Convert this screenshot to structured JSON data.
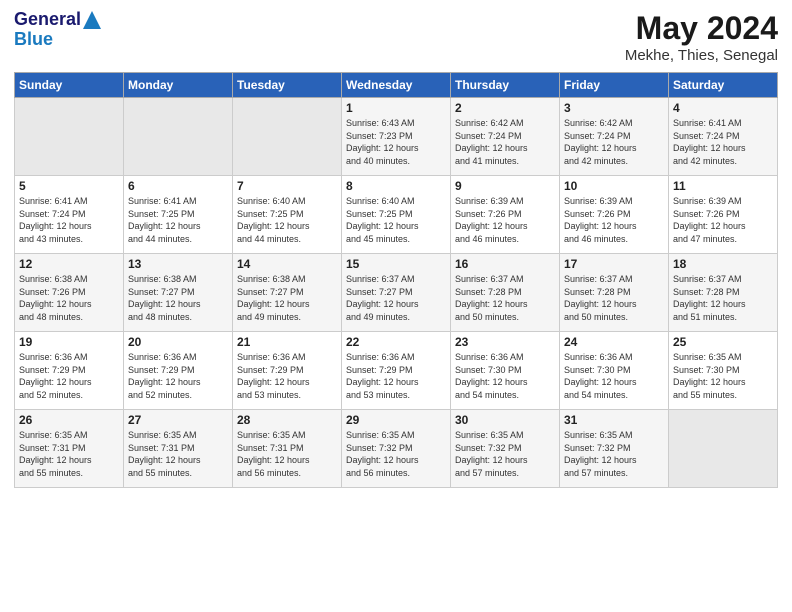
{
  "header": {
    "logo_line1": "General",
    "logo_line2": "Blue",
    "month": "May 2024",
    "location": "Mekhe, Thies, Senegal"
  },
  "days_of_week": [
    "Sunday",
    "Monday",
    "Tuesday",
    "Wednesday",
    "Thursday",
    "Friday",
    "Saturday"
  ],
  "weeks": [
    [
      {
        "day": "",
        "info": ""
      },
      {
        "day": "",
        "info": ""
      },
      {
        "day": "",
        "info": ""
      },
      {
        "day": "1",
        "info": "Sunrise: 6:43 AM\nSunset: 7:23 PM\nDaylight: 12 hours\nand 40 minutes."
      },
      {
        "day": "2",
        "info": "Sunrise: 6:42 AM\nSunset: 7:24 PM\nDaylight: 12 hours\nand 41 minutes."
      },
      {
        "day": "3",
        "info": "Sunrise: 6:42 AM\nSunset: 7:24 PM\nDaylight: 12 hours\nand 42 minutes."
      },
      {
        "day": "4",
        "info": "Sunrise: 6:41 AM\nSunset: 7:24 PM\nDaylight: 12 hours\nand 42 minutes."
      }
    ],
    [
      {
        "day": "5",
        "info": "Sunrise: 6:41 AM\nSunset: 7:24 PM\nDaylight: 12 hours\nand 43 minutes."
      },
      {
        "day": "6",
        "info": "Sunrise: 6:41 AM\nSunset: 7:25 PM\nDaylight: 12 hours\nand 44 minutes."
      },
      {
        "day": "7",
        "info": "Sunrise: 6:40 AM\nSunset: 7:25 PM\nDaylight: 12 hours\nand 44 minutes."
      },
      {
        "day": "8",
        "info": "Sunrise: 6:40 AM\nSunset: 7:25 PM\nDaylight: 12 hours\nand 45 minutes."
      },
      {
        "day": "9",
        "info": "Sunrise: 6:39 AM\nSunset: 7:26 PM\nDaylight: 12 hours\nand 46 minutes."
      },
      {
        "day": "10",
        "info": "Sunrise: 6:39 AM\nSunset: 7:26 PM\nDaylight: 12 hours\nand 46 minutes."
      },
      {
        "day": "11",
        "info": "Sunrise: 6:39 AM\nSunset: 7:26 PM\nDaylight: 12 hours\nand 47 minutes."
      }
    ],
    [
      {
        "day": "12",
        "info": "Sunrise: 6:38 AM\nSunset: 7:26 PM\nDaylight: 12 hours\nand 48 minutes."
      },
      {
        "day": "13",
        "info": "Sunrise: 6:38 AM\nSunset: 7:27 PM\nDaylight: 12 hours\nand 48 minutes."
      },
      {
        "day": "14",
        "info": "Sunrise: 6:38 AM\nSunset: 7:27 PM\nDaylight: 12 hours\nand 49 minutes."
      },
      {
        "day": "15",
        "info": "Sunrise: 6:37 AM\nSunset: 7:27 PM\nDaylight: 12 hours\nand 49 minutes."
      },
      {
        "day": "16",
        "info": "Sunrise: 6:37 AM\nSunset: 7:28 PM\nDaylight: 12 hours\nand 50 minutes."
      },
      {
        "day": "17",
        "info": "Sunrise: 6:37 AM\nSunset: 7:28 PM\nDaylight: 12 hours\nand 50 minutes."
      },
      {
        "day": "18",
        "info": "Sunrise: 6:37 AM\nSunset: 7:28 PM\nDaylight: 12 hours\nand 51 minutes."
      }
    ],
    [
      {
        "day": "19",
        "info": "Sunrise: 6:36 AM\nSunset: 7:29 PM\nDaylight: 12 hours\nand 52 minutes."
      },
      {
        "day": "20",
        "info": "Sunrise: 6:36 AM\nSunset: 7:29 PM\nDaylight: 12 hours\nand 52 minutes."
      },
      {
        "day": "21",
        "info": "Sunrise: 6:36 AM\nSunset: 7:29 PM\nDaylight: 12 hours\nand 53 minutes."
      },
      {
        "day": "22",
        "info": "Sunrise: 6:36 AM\nSunset: 7:29 PM\nDaylight: 12 hours\nand 53 minutes."
      },
      {
        "day": "23",
        "info": "Sunrise: 6:36 AM\nSunset: 7:30 PM\nDaylight: 12 hours\nand 54 minutes."
      },
      {
        "day": "24",
        "info": "Sunrise: 6:36 AM\nSunset: 7:30 PM\nDaylight: 12 hours\nand 54 minutes."
      },
      {
        "day": "25",
        "info": "Sunrise: 6:35 AM\nSunset: 7:30 PM\nDaylight: 12 hours\nand 55 minutes."
      }
    ],
    [
      {
        "day": "26",
        "info": "Sunrise: 6:35 AM\nSunset: 7:31 PM\nDaylight: 12 hours\nand 55 minutes."
      },
      {
        "day": "27",
        "info": "Sunrise: 6:35 AM\nSunset: 7:31 PM\nDaylight: 12 hours\nand 55 minutes."
      },
      {
        "day": "28",
        "info": "Sunrise: 6:35 AM\nSunset: 7:31 PM\nDaylight: 12 hours\nand 56 minutes."
      },
      {
        "day": "29",
        "info": "Sunrise: 6:35 AM\nSunset: 7:32 PM\nDaylight: 12 hours\nand 56 minutes."
      },
      {
        "day": "30",
        "info": "Sunrise: 6:35 AM\nSunset: 7:32 PM\nDaylight: 12 hours\nand 57 minutes."
      },
      {
        "day": "31",
        "info": "Sunrise: 6:35 AM\nSunset: 7:32 PM\nDaylight: 12 hours\nand 57 minutes."
      },
      {
        "day": "",
        "info": ""
      }
    ]
  ]
}
